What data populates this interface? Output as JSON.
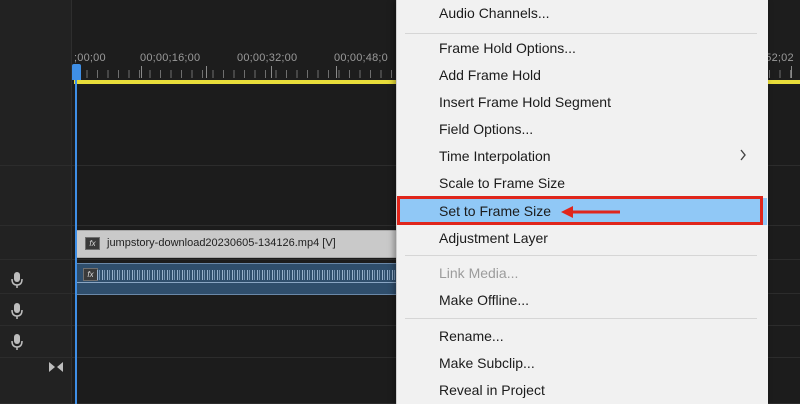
{
  "timeline": {
    "timecodes": [
      ";00;00",
      "00;00;16;00",
      "00;00;32;00",
      "00;00;48;0",
      ";52;02"
    ],
    "video_clip": {
      "name": "jumpstory-download20230605-134126.mp4 [V]",
      "fx_label": "fx"
    },
    "audio_clip": {
      "fx_label": "fx"
    },
    "colors": {
      "playhead": "#3f8fe6",
      "work_area_bar": "#e8dd3a",
      "audio_clip": "#2f4e6c",
      "video_clip": "#c9c9c9"
    }
  },
  "menu": {
    "items": [
      {
        "label": "Audio Channels...",
        "enabled": true
      },
      {
        "label": "Frame Hold Options...",
        "enabled": true
      },
      {
        "label": "Add Frame Hold",
        "enabled": true
      },
      {
        "label": "Insert Frame Hold Segment",
        "enabled": true
      },
      {
        "label": "Field Options...",
        "enabled": true
      },
      {
        "label": "Time Interpolation",
        "enabled": true,
        "submenu": true
      },
      {
        "label": "Scale to Frame Size",
        "enabled": true
      },
      {
        "label": "Set to Frame Size",
        "enabled": true,
        "highlighted": true
      },
      {
        "label": "Adjustment Layer",
        "enabled": true
      },
      {
        "label": "Link Media...",
        "enabled": false
      },
      {
        "label": "Make Offline...",
        "enabled": true
      },
      {
        "label": "Rename...",
        "enabled": true
      },
      {
        "label": "Make Subclip...",
        "enabled": true
      },
      {
        "label": "Reveal in Project",
        "enabled": true
      }
    ],
    "annotation_color": "#e0261c",
    "highlight_color": "#90c8f6"
  },
  "icons": {
    "track_icons": [
      "microphone-icon",
      "microphone-icon",
      "microphone-icon",
      "mix-track-icon"
    ],
    "submenu_arrow": "chevron-right-icon",
    "annotation_arrow": "red-arrow-left-icon"
  }
}
